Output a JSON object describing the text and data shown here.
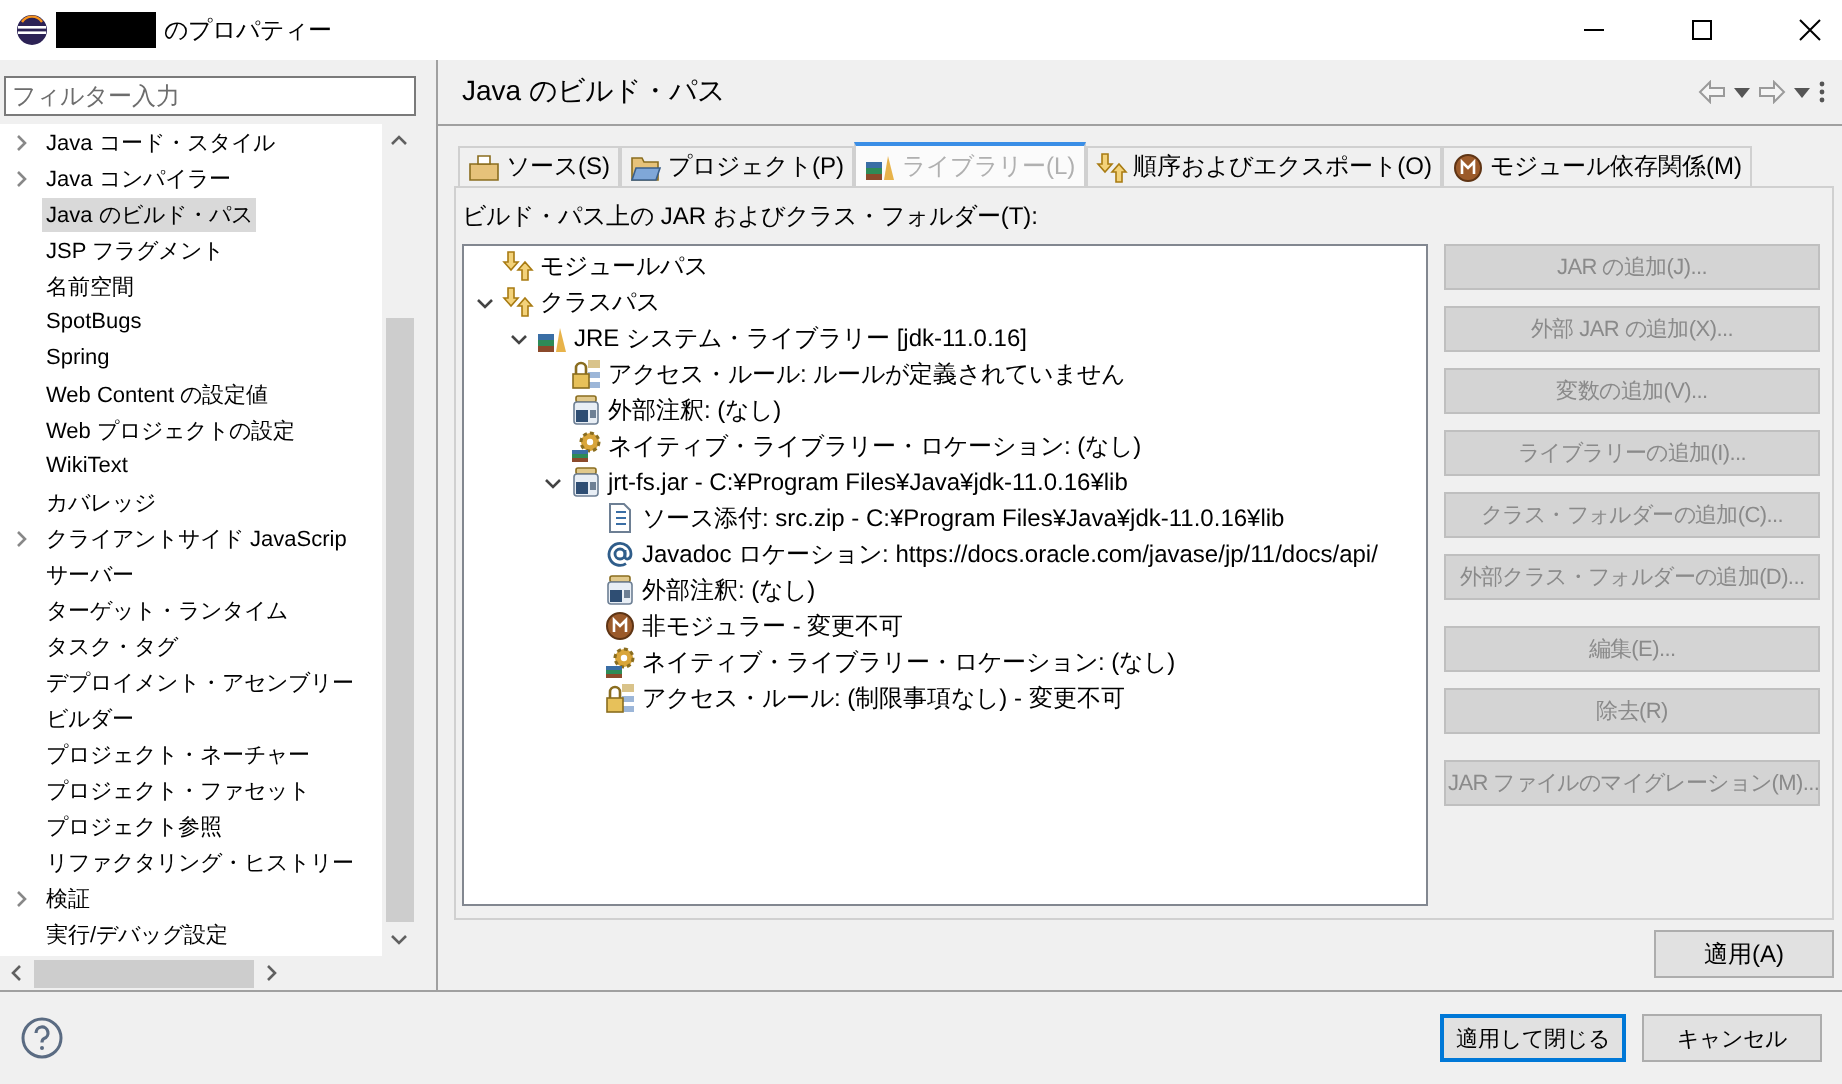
{
  "window": {
    "title": "のプロパティー"
  },
  "filter": {
    "placeholder": "フィルター入力"
  },
  "sidebar": {
    "items": [
      {
        "label": "Java コード・スタイル",
        "kind": "folder",
        "selected": false
      },
      {
        "label": "Java コンパイラー",
        "kind": "folder",
        "selected": false
      },
      {
        "label": "Java のビルド・パス",
        "kind": "page",
        "selected": true
      },
      {
        "label": "JSP フラグメント",
        "kind": "page",
        "selected": false
      },
      {
        "label": "名前空間",
        "kind": "page",
        "selected": false
      },
      {
        "label": "SpotBugs",
        "kind": "page",
        "selected": false
      },
      {
        "label": "Spring",
        "kind": "page",
        "selected": false
      },
      {
        "label": "Web Content の設定値",
        "kind": "page",
        "selected": false
      },
      {
        "label": "Web プロジェクトの設定",
        "kind": "page",
        "selected": false
      },
      {
        "label": "WikiText",
        "kind": "page",
        "selected": false
      },
      {
        "label": "カバレッジ",
        "kind": "page",
        "selected": false
      },
      {
        "label": "クライアントサイド JavaScrip",
        "kind": "folder",
        "selected": false
      },
      {
        "label": "サーバー",
        "kind": "page",
        "selected": false
      },
      {
        "label": "ターゲット・ランタイム",
        "kind": "page",
        "selected": false
      },
      {
        "label": "タスク・タグ",
        "kind": "page",
        "selected": false
      },
      {
        "label": "デプロイメント・アセンブリー",
        "kind": "page",
        "selected": false
      },
      {
        "label": "ビルダー",
        "kind": "page",
        "selected": false
      },
      {
        "label": "プロジェクト・ネーチャー",
        "kind": "page",
        "selected": false
      },
      {
        "label": "プロジェクト・ファセット",
        "kind": "page",
        "selected": false
      },
      {
        "label": "プロジェクト参照",
        "kind": "page",
        "selected": false
      },
      {
        "label": "リファクタリング・ヒストリー",
        "kind": "page",
        "selected": false
      },
      {
        "label": "検証",
        "kind": "folder",
        "selected": false
      },
      {
        "label": "実行/デバッグ設定",
        "kind": "page",
        "selected": false
      }
    ]
  },
  "page": {
    "title": "Java のビルド・パス"
  },
  "tabs": [
    {
      "label": "ソース(S)",
      "kind": "source",
      "selected": false
    },
    {
      "label": "プロジェクト(P)",
      "kind": "project",
      "selected": false
    },
    {
      "label": "ライブラリー(L)",
      "kind": "library",
      "selected": true
    },
    {
      "label": "順序およびエクスポート(O)",
      "kind": "order",
      "selected": false
    },
    {
      "label": "モジュール依存関係(M)",
      "kind": "module",
      "selected": false
    }
  ],
  "build_path": {
    "label": "ビルド・パス上の JAR およびクラス・フォルダー(T):",
    "tree": [
      {
        "label": "モジュールパス",
        "kind": "path-entry"
      },
      {
        "label": "クラスパス",
        "kind": "path-entry",
        "expanded": true,
        "children": [
          {
            "label": "JRE システム・ライブラリー [jdk-11.0.16]",
            "kind": "library",
            "expanded": true,
            "children": [
              {
                "label": "アクセス・ルール: ルールが定義されていません",
                "kind": "access-rules"
              },
              {
                "label": "外部注釈: (なし)",
                "kind": "annotations"
              },
              {
                "label": "ネイティブ・ライブラリー・ロケーション: (なし)",
                "kind": "native"
              },
              {
                "label": "jrt-fs.jar - C:¥Program Files¥Java¥jdk-11.0.16¥lib",
                "kind": "jar",
                "expanded": true,
                "children": [
                  {
                    "label": "ソース添付: src.zip - C:¥Program Files¥Java¥jdk-11.0.16¥lib",
                    "kind": "source-attachment"
                  },
                  {
                    "label": "Javadoc ロケーション: https://docs.oracle.com/javase/jp/11/docs/api/",
                    "kind": "javadoc"
                  },
                  {
                    "label": "外部注釈: (なし)",
                    "kind": "annotations"
                  },
                  {
                    "label": "非モジュラー - 変更不可",
                    "kind": "module"
                  },
                  {
                    "label": "ネイティブ・ライブラリー・ロケーション: (なし)",
                    "kind": "native"
                  },
                  {
                    "label": "アクセス・ルール: (制限事項なし) - 変更不可",
                    "kind": "access-rules"
                  }
                ]
              }
            ]
          }
        ]
      }
    ]
  },
  "side_buttons": [
    [
      {
        "label": "JAR の追加(J)...",
        "disabled": true
      },
      {
        "label": "外部 JAR の追加(X)...",
        "disabled": true
      },
      {
        "label": "変数の追加(V)...",
        "disabled": true
      },
      {
        "label": "ライブラリーの追加(I)...",
        "disabled": true
      },
      {
        "label": "クラス・フォルダーの追加(C)...",
        "disabled": true
      },
      {
        "label": "外部クラス・フォルダーの追加(D)...",
        "disabled": true
      }
    ],
    [
      {
        "label": "編集(E)...",
        "disabled": true
      },
      {
        "label": "除去(R)",
        "disabled": true
      }
    ],
    [
      {
        "label": "JAR ファイルのマイグレーション(M)...",
        "disabled": true
      }
    ]
  ],
  "apply_button": {
    "label": "適用(A)",
    "disabled": false
  },
  "footer_buttons": [
    {
      "label": "適用して閉じる",
      "default": true
    },
    {
      "label": "キャンセル",
      "default": false
    }
  ]
}
